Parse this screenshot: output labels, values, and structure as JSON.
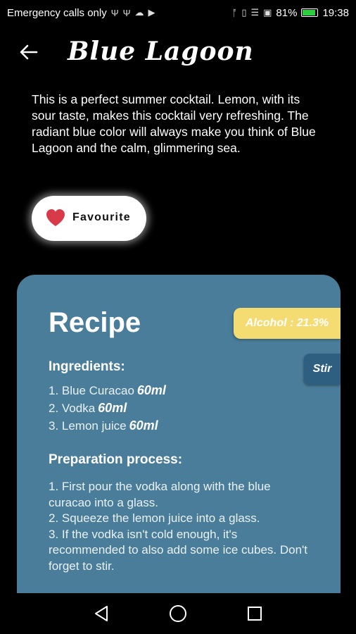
{
  "status_bar": {
    "carrier": "Emergency calls only",
    "battery": "81%",
    "time": "19:38"
  },
  "app_bar": {
    "title": "Blue Lagoon"
  },
  "description": "This is a perfect summer cocktail. Lemon, with its sour taste, makes this cocktail very refreshing. The radiant blue color will always make you think of Blue Lagoon and the calm, glimmering sea.",
  "favourite": {
    "label": "Favourite"
  },
  "recipe": {
    "title": "Recipe",
    "alcohol": "Alcohol : 21.3%",
    "method": "Stir",
    "ingredients_heading": "Ingredients:",
    "ingredients": [
      {
        "name": "1. Blue Curacao",
        "amount": "60ml"
      },
      {
        "name": "2. Vodka",
        "amount": "60ml"
      },
      {
        "name": "3. Lemon juice",
        "amount": "60ml"
      }
    ],
    "preparation_heading": "Preparation process:",
    "preparation_lines": [
      "1. First pour the vodka along with the blue curacao into a glass.",
      "2. Squeeze the lemon juice into a glass.",
      "3. If the vodka isn't cold enough, it's recommended to also add some ice cubes. Don't forget to stir."
    ]
  },
  "colors": {
    "card": "#4a7d9a",
    "alcohol_badge": "#f5dc72",
    "method_badge": "#2f5f80",
    "heart": "#d93a49"
  }
}
